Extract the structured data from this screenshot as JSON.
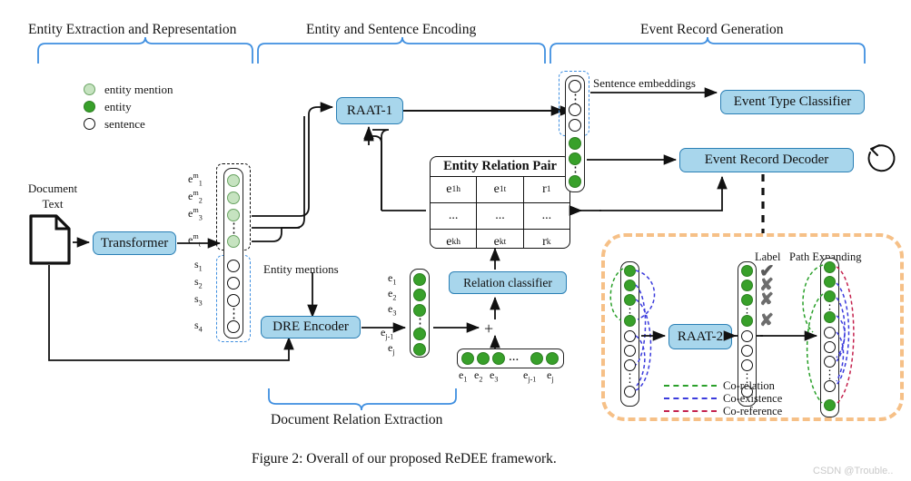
{
  "figure": {
    "caption": "Figure 2: Overall of our proposed ReDEE framework.",
    "watermark": "CSDN @Trouble.."
  },
  "phases": [
    {
      "id": "entity-extraction",
      "label": "Entity Extraction and Representation"
    },
    {
      "id": "entity-sentence-encoding",
      "label": "Entity and Sentence Encoding"
    },
    {
      "id": "event-record-generation",
      "label": "Event Record Generation"
    },
    {
      "id": "document-relation-extraction",
      "label": "Document Relation Extraction"
    }
  ],
  "legend": {
    "items": [
      {
        "marker": "entity-mention-circle",
        "label": "entity mention",
        "color": "#c6e3c0"
      },
      {
        "marker": "entity-circle",
        "label": "entity",
        "color": "#38a02a"
      },
      {
        "marker": "sentence-circle",
        "label": "sentence",
        "color": "#ffffff"
      }
    ]
  },
  "input": {
    "label_line1": "Document",
    "label_line2": "Text",
    "icon": "document-icon"
  },
  "modules": {
    "transformer": "Transformer",
    "raat1": "RAAT-1",
    "raat2": "RAAT-2",
    "dre_encoder": "DRE Encoder",
    "relation_classifier": "Relation classifier",
    "event_type_classifier": "Event Type Classifier",
    "event_record_decoder": "Event Record Decoder"
  },
  "edge_labels": {
    "entity_mentions": "Entity mentions",
    "sentence_embeddings": "Sentence embeddings",
    "label": "Label",
    "path_expanding": "Path Expanding",
    "plus": "+"
  },
  "token_column": {
    "mention_labels": [
      "e",
      "e",
      "e",
      "e"
    ],
    "mention_sup": "m",
    "mention_sub": [
      "1",
      "2",
      "3",
      "t"
    ],
    "sentence_labels": [
      "s",
      "s",
      "s",
      "s"
    ],
    "sentence_sub": [
      "1",
      "2",
      "3",
      "4"
    ]
  },
  "entity_column": {
    "labels": [
      "e",
      "e",
      "e",
      "e",
      "e"
    ],
    "subs": [
      "1",
      "2",
      "3",
      "j-1",
      "j"
    ]
  },
  "entity_row": {
    "labels": [
      "e",
      "e",
      "e",
      "e",
      "e"
    ],
    "subs": [
      "1",
      "2",
      "3",
      "j-1",
      "j"
    ],
    "ellipsis": "..."
  },
  "entity_relation_pair": {
    "title": "Entity Relation Pair",
    "rows": [
      [
        "e₁ʰ",
        "e₁ᵗ",
        "r₁"
      ],
      [
        "...",
        "...",
        "..."
      ],
      [
        "eₖʰ",
        "eₖᵗ",
        "rₖ"
      ]
    ],
    "cells": [
      [
        {
          "base": "e",
          "sub": "1",
          "sup": "h"
        },
        {
          "base": "e",
          "sub": "1",
          "sup": "t"
        },
        {
          "base": "r",
          "sub": "1",
          "sup": ""
        }
      ],
      [
        {
          "base": "...",
          "sub": "",
          "sup": ""
        },
        {
          "base": "...",
          "sub": "",
          "sup": ""
        },
        {
          "base": "...",
          "sub": "",
          "sup": ""
        }
      ],
      [
        {
          "base": "e",
          "sub": "k",
          "sup": "h"
        },
        {
          "base": "e",
          "sub": "k",
          "sup": "t"
        },
        {
          "base": "r",
          "sub": "k",
          "sup": ""
        }
      ]
    ]
  },
  "path_legend": [
    {
      "label": "Co-relation",
      "color": "#2aa02a"
    },
    {
      "label": "Co-existence",
      "color": "#3b3bdc"
    },
    {
      "label": "Co-reference",
      "color": "#c4224e"
    }
  ],
  "label_marks": [
    "✔",
    "✘",
    "✘",
    "✘"
  ],
  "colors": {
    "box_fill": "#a8d6ec",
    "box_stroke": "#2a7fb5",
    "entity": "#38a02a",
    "entity_mention": "#c6e3c0",
    "brace": "#3f8fe0",
    "orange_dash": "#f6c087",
    "blue_dash": "#3f8fe0"
  }
}
